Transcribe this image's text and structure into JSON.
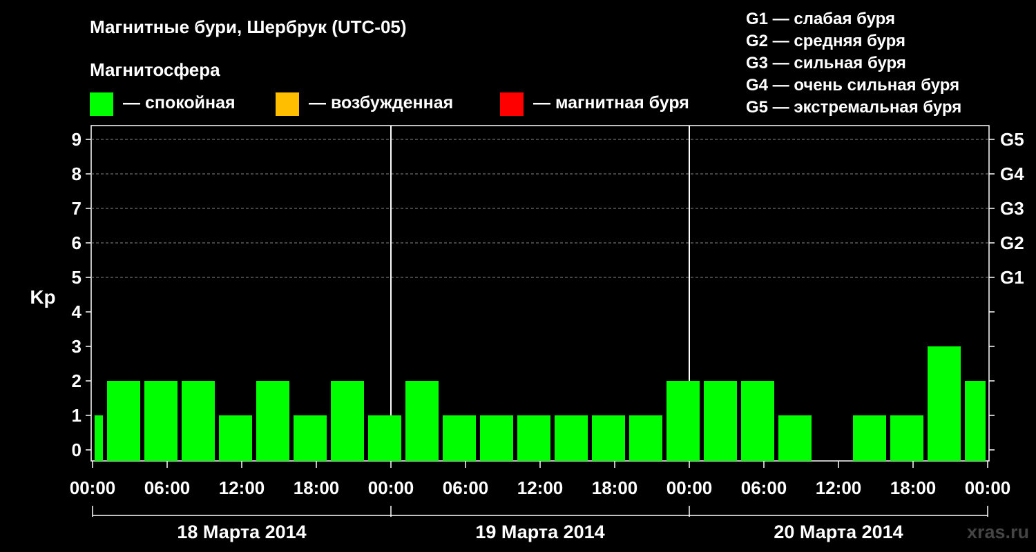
{
  "title": "Магнитные бури, Шербрук (UTC-05)",
  "magnetosphere": {
    "title": "Магнитосфера",
    "items": [
      {
        "label": "— спокойная",
        "color": "#00ff00"
      },
      {
        "label": "— возбужденная",
        "color": "#ffbf00"
      },
      {
        "label": "— магнитная буря",
        "color": "#ff0000"
      }
    ]
  },
  "storm_legend": [
    "G1 — слабая буря",
    "G2 — средняя буря",
    "G3 — сильная буря",
    "G4 — очень сильная буря",
    "G5 — экстремальная буря"
  ],
  "watermark": "xras.ru",
  "chart_data": {
    "type": "bar",
    "ylabel": "Kp",
    "ylim": [
      0,
      9
    ],
    "yticks": [
      0,
      1,
      2,
      3,
      4,
      5,
      6,
      7,
      8,
      9
    ],
    "right_ticks": [
      {
        "value": 5,
        "label": "G1"
      },
      {
        "value": 6,
        "label": "G2"
      },
      {
        "value": 7,
        "label": "G3"
      },
      {
        "value": 8,
        "label": "G4"
      },
      {
        "value": 9,
        "label": "G5"
      }
    ],
    "grid": "dashed horizontal at 5-9",
    "x_tick_labels": [
      "00:00",
      "06:00",
      "12:00",
      "18:00",
      "00:00",
      "06:00",
      "12:00",
      "18:00",
      "00:00",
      "06:00",
      "12:00",
      "18:00",
      "00:00"
    ],
    "days": [
      "18 Марта 2014",
      "19 Марта 2014",
      "20 Марта 2014"
    ],
    "bars": [
      {
        "start_hour": 0,
        "end_hour": 1,
        "kp": 1
      },
      {
        "start_hour": 1,
        "end_hour": 4,
        "kp": 2
      },
      {
        "start_hour": 4,
        "end_hour": 7,
        "kp": 2
      },
      {
        "start_hour": 7,
        "end_hour": 10,
        "kp": 2
      },
      {
        "start_hour": 10,
        "end_hour": 13,
        "kp": 1
      },
      {
        "start_hour": 13,
        "end_hour": 16,
        "kp": 2
      },
      {
        "start_hour": 16,
        "end_hour": 19,
        "kp": 1
      },
      {
        "start_hour": 19,
        "end_hour": 22,
        "kp": 2
      },
      {
        "start_hour": 22,
        "end_hour": 25,
        "kp": 1
      },
      {
        "start_hour": 25,
        "end_hour": 28,
        "kp": 2
      },
      {
        "start_hour": 28,
        "end_hour": 31,
        "kp": 1
      },
      {
        "start_hour": 31,
        "end_hour": 34,
        "kp": 1
      },
      {
        "start_hour": 34,
        "end_hour": 37,
        "kp": 1
      },
      {
        "start_hour": 37,
        "end_hour": 40,
        "kp": 1
      },
      {
        "start_hour": 40,
        "end_hour": 43,
        "kp": 1
      },
      {
        "start_hour": 43,
        "end_hour": 46,
        "kp": 1
      },
      {
        "start_hour": 46,
        "end_hour": 49,
        "kp": 2
      },
      {
        "start_hour": 49,
        "end_hour": 52,
        "kp": 2
      },
      {
        "start_hour": 52,
        "end_hour": 55,
        "kp": 2
      },
      {
        "start_hour": 55,
        "end_hour": 58,
        "kp": 1
      },
      {
        "start_hour": 58,
        "end_hour": 61,
        "kp": 0
      },
      {
        "start_hour": 61,
        "end_hour": 64,
        "kp": 1
      },
      {
        "start_hour": 64,
        "end_hour": 67,
        "kp": 1
      },
      {
        "start_hour": 67,
        "end_hour": 70,
        "kp": 3
      },
      {
        "start_hour": 70,
        "end_hour": 72,
        "kp": 2
      }
    ],
    "bar_color": "#00ff00"
  }
}
